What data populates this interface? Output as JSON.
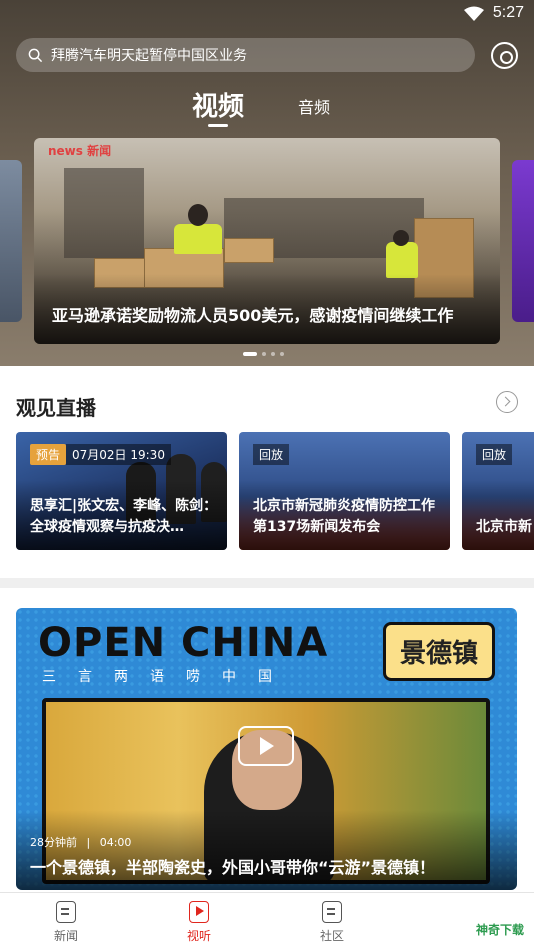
{
  "status_bar": {
    "time": "5:27"
  },
  "search": {
    "text": "拜腾汽车明天起暂停中国区业务"
  },
  "tabs": {
    "video": "视频",
    "audio": "音频"
  },
  "banner": {
    "caption": "亚马逊承诺奖励物流人员500美元，感谢疫情间继续工作",
    "logo": "news 新闻",
    "slide_count": 4,
    "active_slide": 1
  },
  "live": {
    "title": "观见直播",
    "cards": [
      {
        "tag": "预告",
        "time": "07月02日 19:30",
        "title": "思享汇|张文宏、李峰、陈剑：全球疫情观察与抗疫决…",
        "bg": "#24406e"
      },
      {
        "tag": "回放",
        "time": "",
        "title": "北京市新冠肺炎疫情防控工作第137场新闻发布会",
        "bg": "#3b5d9a"
      },
      {
        "tag": "回放",
        "time": "",
        "title": "北京市新",
        "bg": "#3b5d9a"
      }
    ]
  },
  "feature": {
    "brand": "OPEN CHINA",
    "subtitle": [
      "三",
      "言",
      "两",
      "语",
      "唠",
      "中",
      "国"
    ],
    "badge": "景德镇",
    "meta_time": "28分钟前",
    "meta_divider": "|",
    "duration": "04:00",
    "title": "一个景德镇，半部陶瓷史，外国小哥带你“云游”景德镇！"
  },
  "nav": {
    "items": [
      {
        "label": "新闻",
        "active": false
      },
      {
        "label": "视听",
        "active": true
      },
      {
        "label": "社区",
        "active": false
      }
    ],
    "watermark": "神奇下载"
  },
  "colors": {
    "accent": "#e0261e",
    "preview_tag": "#e6a23c"
  }
}
